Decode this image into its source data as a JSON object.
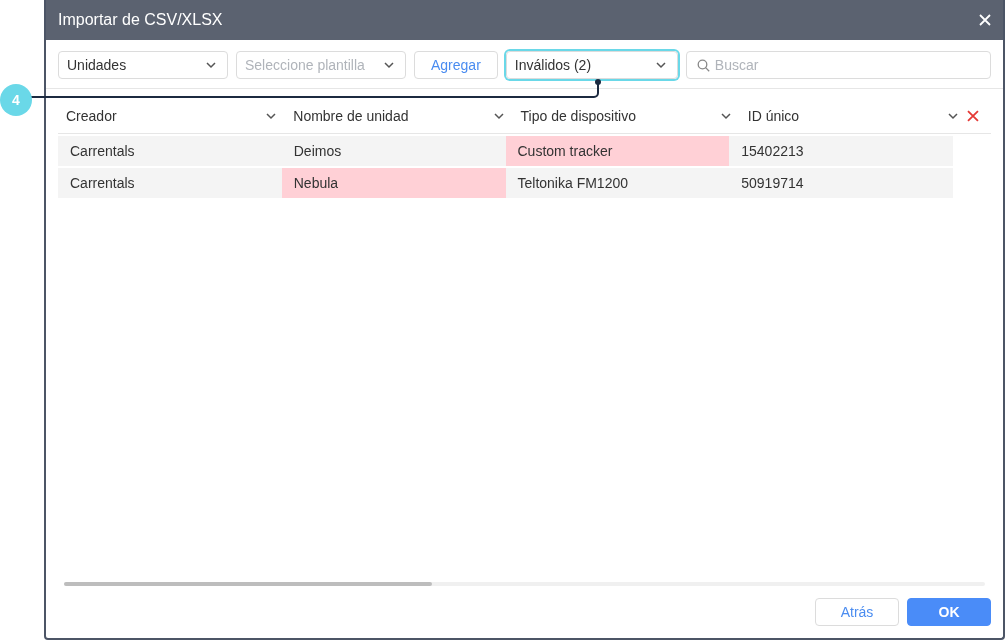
{
  "window": {
    "title": "Importar de CSV/XLSX"
  },
  "toolbar": {
    "type_select": {
      "value": "Unidades"
    },
    "template_select": {
      "placeholder": "Seleccione plantilla"
    },
    "add_button": "Agregar",
    "filter_select": {
      "value": "Inválidos (2)",
      "highlighted": true
    },
    "search": {
      "placeholder": "Buscar"
    }
  },
  "callout": {
    "label": "4"
  },
  "table": {
    "columns": [
      "Creador",
      "Nombre de unidad",
      "Tipo de dispositivo",
      "ID único"
    ],
    "rows": [
      {
        "cells": [
          {
            "text": "Carrentals",
            "invalid": false
          },
          {
            "text": "Deimos",
            "invalid": false
          },
          {
            "text": "Custom tracker",
            "invalid": true
          },
          {
            "text": "15402213",
            "invalid": false
          }
        ]
      },
      {
        "cells": [
          {
            "text": "Carrentals",
            "invalid": false
          },
          {
            "text": "Nebula",
            "invalid": true
          },
          {
            "text": "Teltonika FM1200",
            "invalid": false
          },
          {
            "text": "50919714",
            "invalid": false
          }
        ]
      }
    ]
  },
  "buttons": [
    {
      "label": "Atrás",
      "kind": "secondary"
    },
    {
      "label": "OK",
      "kind": "primary"
    }
  ]
}
